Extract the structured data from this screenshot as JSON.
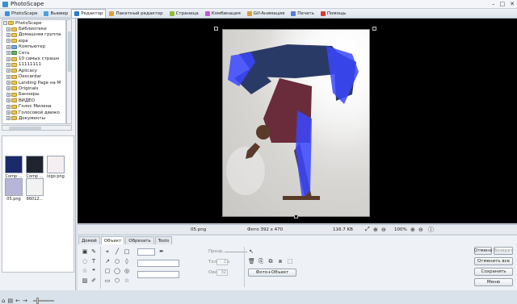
{
  "app": {
    "title": "PhotoScape"
  },
  "tabs": [
    {
      "label": "PhotoScape",
      "color": "#3f8fd8"
    },
    {
      "label": "Вьювер",
      "color": "#4aa0e0"
    },
    {
      "label": "Редактор",
      "color": "#2e7bd0"
    },
    {
      "label": "Пакетный редактор",
      "color": "#e0a03a"
    },
    {
      "label": "Страница",
      "color": "#8bbf3a"
    },
    {
      "label": "Комбинация",
      "color": "#c05ad8"
    },
    {
      "label": "Gif-Анимация",
      "color": "#d8a03a"
    },
    {
      "label": "Печать",
      "color": "#5a7ad8"
    },
    {
      "label": "Помощь",
      "color": "#d83a3a"
    }
  ],
  "tree": {
    "items": [
      "PhotoScape",
      "Библиотеки",
      "Домашняя группа",
      "юра",
      "Компьютер",
      "Сеть",
      "10 самых страшн",
      "11111111",
      "Aplicacy",
      "Descardar",
      "Landing Page на M",
      "Originals",
      "Баннеры",
      "ВИДЕО",
      "Голос Милена",
      "Голосовой движо",
      "Документы"
    ]
  },
  "thumbnails": [
    {
      "name": "Comp ...",
      "color": "#1a2a6a"
    },
    {
      "name": "Comp ...",
      "color": "#20242e"
    },
    {
      "name": "logo.png",
      "color": "#f4eef2"
    },
    {
      "name": "05.png",
      "color": "#b7b5d8"
    },
    {
      "name": "86012...",
      "color": "#f2f2f2"
    }
  ],
  "status": {
    "filename": "05.png",
    "photo_info": "Фото 392 x 470",
    "filesize": "116.7 KB",
    "zoom": "100%"
  },
  "panel_tabs": [
    "Домой",
    "Объект",
    "Обрезать",
    "Tools"
  ],
  "object_panel": {
    "opacity_label": "Прозр.",
    "thickness_label": "Толщина",
    "thickness_value": "2",
    "oval_label": "Овал",
    "oval_value": "32",
    "photo_object_button": "Фото+Объект"
  },
  "actions": {
    "undo": "Отмена",
    "redo": "Возврат",
    "undo_all": "Отменить все",
    "save": "Сохранить",
    "menu": "Меню"
  }
}
